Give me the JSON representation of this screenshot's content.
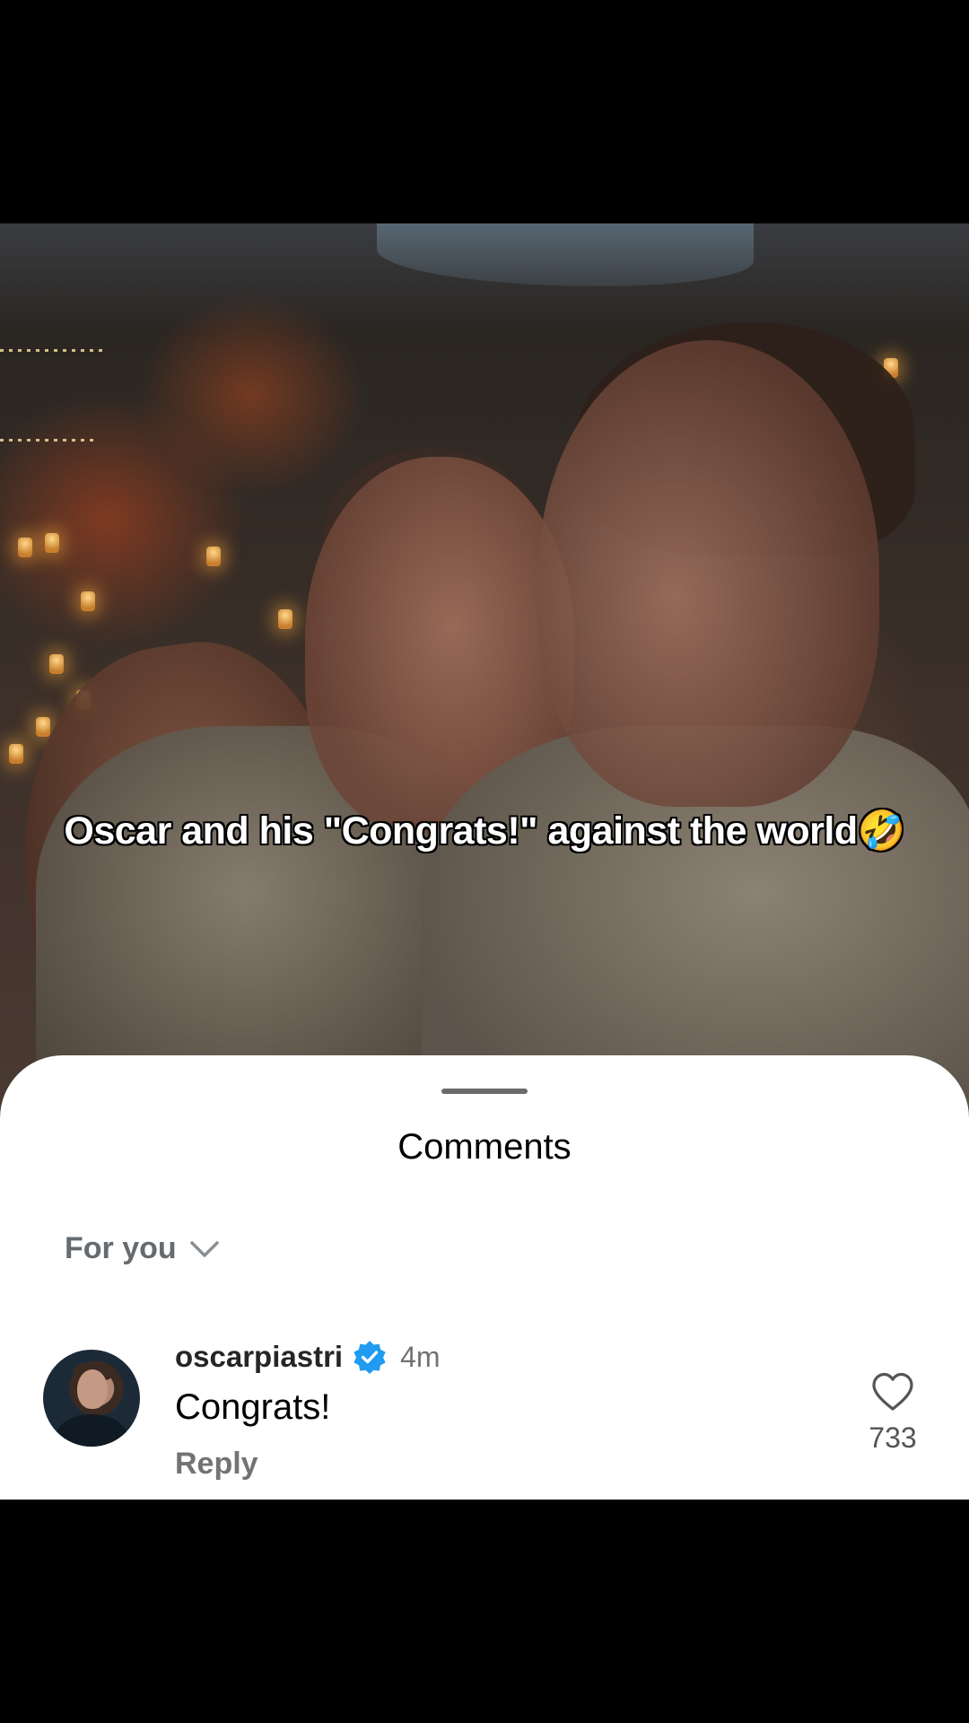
{
  "video": {
    "caption": "Oscar and his \"Congrats!\" against the world🤣"
  },
  "comments_sheet": {
    "title": "Comments",
    "filter_label": "For you",
    "filter_icon": "chevron-down-icon",
    "comments": [
      {
        "username": "oscarpiastri",
        "verified": true,
        "time": "4m",
        "text": "Congrats!",
        "reply_label": "Reply",
        "like_count": "733",
        "like_icon": "heart-outline-icon"
      }
    ]
  },
  "colors": {
    "verified_badge": "#1f9bf0",
    "sheet_background": "#ffffff",
    "muted_text": "#737373"
  }
}
